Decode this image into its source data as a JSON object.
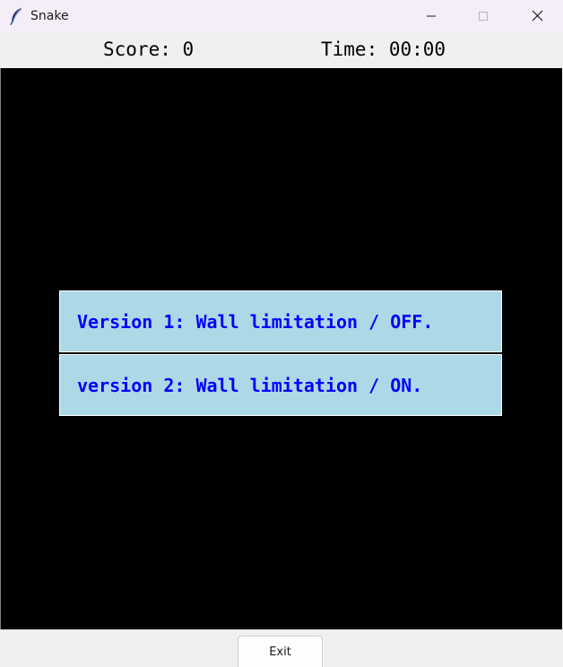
{
  "window": {
    "title": "Snake",
    "icon": "feather-icon",
    "controls": [
      "minimize-icon",
      "maximize-icon",
      "close-icon"
    ]
  },
  "info": {
    "score": "Score: 0",
    "time": "Time: 00:00"
  },
  "menu": {
    "version1": "Version 1: Wall limitation / OFF.",
    "version2": "version 2: Wall limitation / ON."
  },
  "footer": {
    "exit_label": "Exit"
  },
  "colors": {
    "canvas": "#000000",
    "button_bg": "#add8e6",
    "button_text": "#0000ff",
    "titlebar": "#f3eef8"
  }
}
